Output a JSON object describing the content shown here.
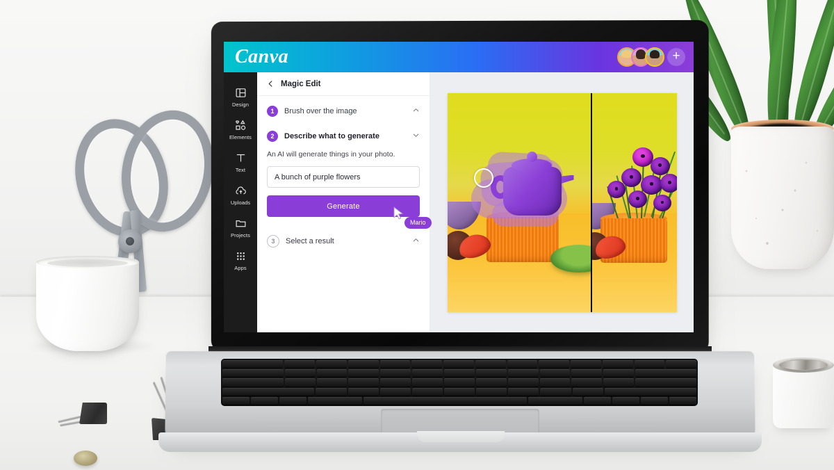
{
  "scene": {
    "description": "White desk with a MacBook Pro displaying the Canva Magic Edit tool, scissors in a white cup, binder clips, a snake plant in a white speckled pot and a silver-rimmed candle"
  },
  "app": {
    "name": "Canva",
    "logo_text": "Canva",
    "topbar": {
      "gradient_from": "#00c4cc",
      "gradient_mid": "#2a6df4",
      "gradient_to": "#8b3dd8",
      "add_member_label": "+",
      "collaborators": [
        {
          "name": "collaborator-1",
          "ring_color": "#f0a83c"
        },
        {
          "name": "collaborator-2",
          "ring_color": "#e875c8"
        },
        {
          "name": "collaborator-3",
          "ring_color": "#f5c518"
        }
      ]
    },
    "sidebar": {
      "items": [
        {
          "label": "Design",
          "icon": "layout-icon"
        },
        {
          "label": "Elements",
          "icon": "shapes-icon"
        },
        {
          "label": "Text",
          "icon": "text-icon"
        },
        {
          "label": "Uploads",
          "icon": "upload-cloud-icon"
        },
        {
          "label": "Projects",
          "icon": "folder-icon"
        },
        {
          "label": "Apps",
          "icon": "grid-apps-icon"
        }
      ]
    },
    "panel": {
      "back_icon": "chevron-left-icon",
      "title": "Magic Edit",
      "steps": [
        {
          "number": "1",
          "label": "Brush over the image",
          "state": "done",
          "chevron": "chevron-up-icon"
        },
        {
          "number": "2",
          "label": "Describe what to generate",
          "state": "active",
          "chevron": "chevron-down-icon"
        },
        {
          "number": "3",
          "label": "Select a result",
          "state": "inactive",
          "chevron": "chevron-up-icon"
        }
      ],
      "hint": "An AI will generate things in your photo.",
      "prompt_value": "A bunch of purple flowers",
      "prompt_placeholder": "Describe what to generate",
      "generate_label": "Generate",
      "accent_color": "#8b3dd8"
    },
    "cursor": {
      "name": "Mario",
      "color": "#8b3dd8"
    },
    "canvas": {
      "split_view": true,
      "before_label": "brushed teapot with purple mask",
      "after_label": "generated purple flowers",
      "brush_cursor": "brush-circle-cursor"
    }
  }
}
